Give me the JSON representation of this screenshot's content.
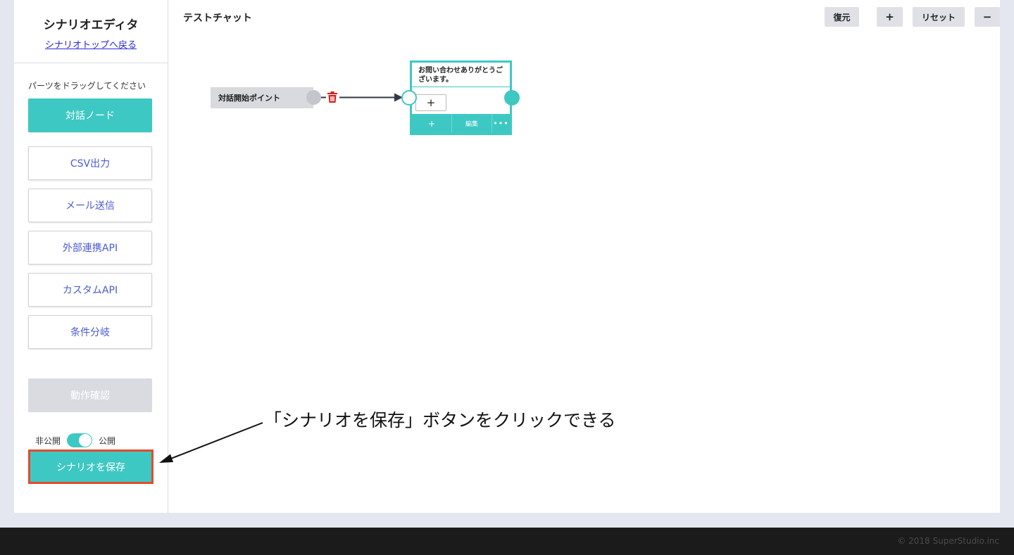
{
  "sidebar": {
    "title": "シナリオエディタ",
    "back_link": "シナリオトップへ戻る",
    "hint": "パーツをドラッグしてください",
    "parts": [
      "対話ノード",
      "CSV出力",
      "メール送信",
      "外部連携API",
      "カスタムAPI",
      "条件分岐"
    ],
    "test_button": "動作確認",
    "toggle": {
      "off_label": "非公開",
      "on_label": "公開",
      "state": "公開"
    },
    "save_button": "シナリオを保存"
  },
  "main": {
    "title": "テストチャット",
    "toolbar": {
      "restore": "復元",
      "zoom_in": "+",
      "reset": "リセット",
      "zoom_out": "−"
    },
    "start_point": "対話開始ポイント",
    "node": {
      "text": "お問い合わせありがとうございます。",
      "add": "+",
      "footer_add": "+",
      "footer_edit": "編集",
      "footer_more": "•••"
    }
  },
  "annotation": "「シナリオを保存」ボタンをクリックできる",
  "footer": {
    "copyright": "© 2018 SuperStudio.inc"
  },
  "colors": {
    "accent": "#3ec8c3",
    "highlight": "#e54a2c",
    "link": "#2a2ad6",
    "delete": "#d0211c"
  }
}
